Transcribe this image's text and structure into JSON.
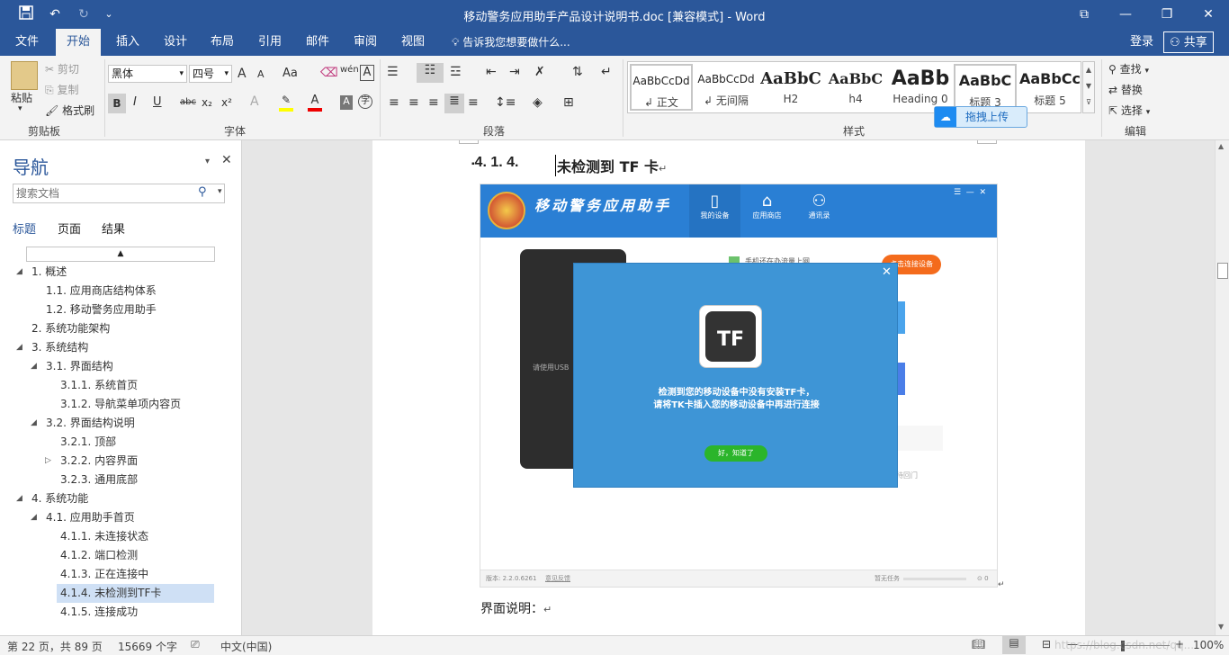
{
  "titlebar": {
    "title": "移动警务应用助手产品设计说明书.doc [兼容模式] - Word",
    "save_icon": "save-icon",
    "undo": "↶",
    "redo": "↻",
    "customize": "⌄",
    "restore_ribbon": "⧉",
    "minimize": "—",
    "maximize": "❐",
    "close": "✕"
  },
  "tabs": [
    "文件",
    "开始",
    "插入",
    "设计",
    "布局",
    "引用",
    "邮件",
    "审阅",
    "视图"
  ],
  "tell_me": "告诉我您想要做什么...",
  "login": "登录",
  "share": "共享",
  "ribbon": {
    "clipboard": {
      "paste": "粘贴",
      "cut": "剪切",
      "copy": "复制",
      "format_painter": "格式刷",
      "label": "剪贴板"
    },
    "font": {
      "name": "黑体",
      "size": "四号",
      "grow": "A",
      "shrink": "A",
      "case": "Aa",
      "label": "字体",
      "bold": "B",
      "italic": "I",
      "underline": "U",
      "strike": "abc",
      "sub": "x₂",
      "sup": "x²",
      "clear": "A",
      "pinyin": "wén",
      "border": "A"
    },
    "paragraph": {
      "label": "段落"
    },
    "styles": {
      "label": "样式",
      "items": [
        {
          "sample": "AaBbCcDd",
          "name": "正文"
        },
        {
          "sample": "AaBbCcDd",
          "name": "无间隔"
        },
        {
          "sample": "AaBbC",
          "name": "H2"
        },
        {
          "sample": "AaBbC",
          "name": "h4"
        },
        {
          "sample": "AaBb",
          "name": "Heading 0"
        },
        {
          "sample": "AaBbC",
          "name": "标题 3 Ch..."
        },
        {
          "sample": "AaBbCc",
          "name": "标题 5"
        }
      ]
    },
    "editing": {
      "find": "查找",
      "replace": "替换",
      "select": "选择",
      "label": "编辑"
    },
    "upload_btn": "拖拽上传"
  },
  "nav": {
    "title": "导航",
    "search_placeholder": "搜索文档",
    "tabs": [
      "标题",
      "页面",
      "结果"
    ],
    "items": [
      {
        "label": "1. 概述",
        "level": 1,
        "expander": "◢"
      },
      {
        "label": "1.1. 应用商店结构体系",
        "level": 2,
        "expander": ""
      },
      {
        "label": "1.2. 移动警务应用助手",
        "level": 2,
        "expander": ""
      },
      {
        "label": "2. 系统功能架构",
        "level": 1,
        "expander": ""
      },
      {
        "label": "3. 系统结构",
        "level": 1,
        "expander": "◢"
      },
      {
        "label": "3.1. 界面结构",
        "level": 2,
        "expander": "◢"
      },
      {
        "label": "3.1.1. 系统首页",
        "level": 3,
        "expander": ""
      },
      {
        "label": "3.1.2. 导航菜单项内容页",
        "level": 3,
        "expander": ""
      },
      {
        "label": "3.2. 界面结构说明",
        "level": 2,
        "expander": "◢"
      },
      {
        "label": "3.2.1. 顶部",
        "level": 3,
        "expander": ""
      },
      {
        "label": "3.2.2. 内容界面",
        "level": 3,
        "expander": "▷"
      },
      {
        "label": "3.2.3. 通用底部",
        "level": 3,
        "expander": ""
      },
      {
        "label": "4. 系统功能",
        "level": 1,
        "expander": "◢"
      },
      {
        "label": "4.1. 应用助手首页",
        "level": 2,
        "expander": "◢"
      },
      {
        "label": "4.1.1. 未连接状态",
        "level": 3,
        "expander": ""
      },
      {
        "label": "4.1.2. 端口检测",
        "level": 3,
        "expander": ""
      },
      {
        "label": "4.1.3. 正在连接中",
        "level": 3,
        "expander": ""
      },
      {
        "label": "4.1.4. 未检测到TF卡",
        "level": 3,
        "expander": "",
        "selected": true
      },
      {
        "label": "4.1.5. 连接成功",
        "level": 3,
        "expander": ""
      }
    ]
  },
  "document": {
    "heading_num": "4. 1. 4.",
    "heading_text": "未检测到 TF 卡",
    "para_mark": "↵",
    "body_text": "界面说明：",
    "app": {
      "app_name": "移动警务应用助手",
      "tabs": [
        "我的设备",
        "应用商店",
        "通讯录"
      ],
      "connect_btn": "点击连接设备",
      "notice": "手机还在办流量上网",
      "hint": "请使用USB",
      "dialog_title_icon": "TF",
      "dialog_line1": "检测到您的移动设备中没有安装TF卡，",
      "dialog_line2": "请将TK卡插入您的移动设备中再进行连接",
      "dialog_btn": "好，知道了",
      "footer_version": "版本: 2.2.0.6261",
      "footer_feedback": "意见反馈",
      "footer_task": "暂无任务",
      "footer_count": "0",
      "side_text": "待回门"
    }
  },
  "status": {
    "page": "第 22 页，共 89 页",
    "words": "15669 个字",
    "lang": "中文(中国)",
    "zoom": "100%",
    "watermark": "https://blog.csdn.net/qq..."
  }
}
